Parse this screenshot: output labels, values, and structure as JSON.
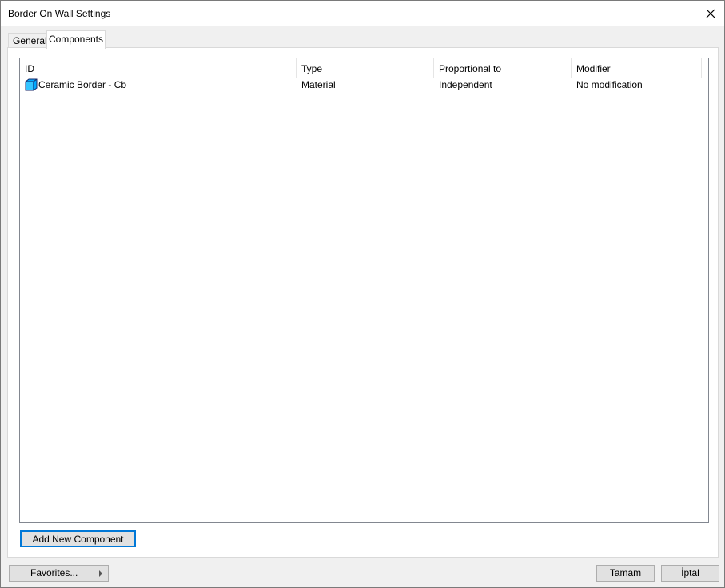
{
  "window": {
    "title": "Border On Wall Settings"
  },
  "tabs": [
    {
      "label": "General",
      "active": false
    },
    {
      "label": "Components",
      "active": true
    }
  ],
  "list": {
    "columns": [
      "ID",
      "Type",
      "Proportional to",
      "Modifier"
    ],
    "rows": [
      {
        "icon": "material-cube-icon",
        "id": "Ceramic Border - Cb",
        "type": "Material",
        "proportional_to": "Independent",
        "modifier": "No modification"
      }
    ]
  },
  "buttons": {
    "add_component": "Add New Component",
    "favorites": "Favorites...",
    "ok": "Tamam",
    "cancel": "İptal"
  },
  "colors": {
    "focus_border": "#0078d7",
    "icon_fill": "#00aaff"
  }
}
